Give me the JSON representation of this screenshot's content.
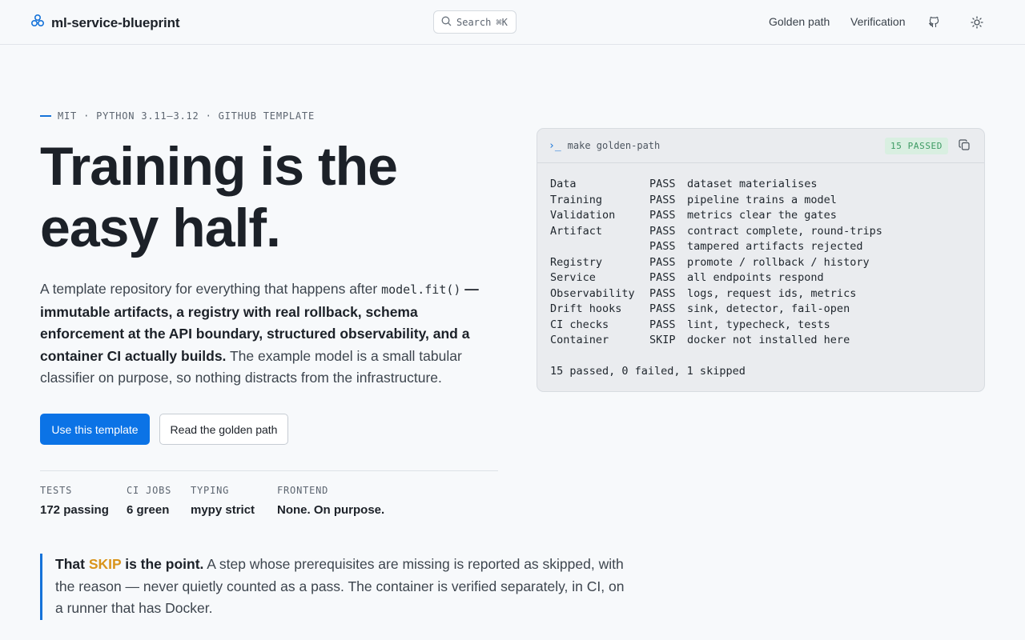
{
  "header": {
    "brand": "ml-service-blueprint",
    "brand_icon": "cube-cluster-icon",
    "search_label": "Search",
    "search_shortcut": "⌘K",
    "nav": [
      {
        "label": "Golden path"
      },
      {
        "label": "Verification"
      }
    ],
    "icons": [
      "github-icon",
      "theme-toggle-icon"
    ]
  },
  "hero": {
    "eyebrow": "MIT · PYTHON 3.11–3.12 · GITHUB TEMPLATE",
    "headline_line1": "Training is the",
    "headline_line2": "easy half.",
    "lead_intro": "A template repository for everything that happens after ",
    "lead_code": "model.fit()",
    "lead_strong": " — immutable artifacts, a registry with real rollback, schema enforcement at the API boundary, structured observability, and a container CI actually builds.",
    "lead_outro": " The example model is a small tabular classifier on purpose, so nothing distracts from the infrastructure.",
    "primary_button": "Use this template",
    "secondary_button": "Read the golden path",
    "stats": [
      {
        "label": "TESTS",
        "value": "172 passing"
      },
      {
        "label": "CI JOBS",
        "value": "6 green"
      },
      {
        "label": "TYPING",
        "value": "mypy strict"
      },
      {
        "label": "FRONTEND",
        "value": "None. On purpose."
      }
    ]
  },
  "terminal": {
    "prompt": "›_",
    "command": "make golden-path",
    "badge": "15 PASSED",
    "badge_color": "#3d9a63",
    "rows": [
      {
        "step": "Data",
        "status": "PASS",
        "detail": "dataset materialises"
      },
      {
        "step": "Training",
        "status": "PASS",
        "detail": "pipeline trains a model"
      },
      {
        "step": "Validation",
        "status": "PASS",
        "detail": "metrics clear the gates"
      },
      {
        "step": "Artifact",
        "status": "PASS",
        "detail": "contract complete, round-trips"
      },
      {
        "step": "",
        "status": "PASS",
        "detail": "tampered artifacts rejected"
      },
      {
        "step": "Registry",
        "status": "PASS",
        "detail": "promote / rollback / history"
      },
      {
        "step": "Service",
        "status": "PASS",
        "detail": "all endpoints respond"
      },
      {
        "step": "Observability",
        "status": "PASS",
        "detail": "logs, request ids, metrics"
      },
      {
        "step": "Drift hooks",
        "status": "PASS",
        "detail": "sink, detector, fail-open"
      },
      {
        "step": "CI checks",
        "status": "PASS",
        "detail": "lint, typecheck, tests"
      },
      {
        "step": "Container",
        "status": "SKIP",
        "detail": "docker not installed here"
      }
    ],
    "summary": "15 passed, 0 failed, 1 skipped"
  },
  "callout": {
    "strong_pre": "That ",
    "skip_word": "SKIP",
    "strong_post": " is the point.",
    "body": " A step whose prerequisites are missing is reported as skipped, with the reason — never quietly counted as a pass. The container is verified separately, in CI, on a runner that has Docker."
  },
  "colors": {
    "accent": "#0b73e6",
    "skip": "#d9941b",
    "background": "#f7f9fb"
  }
}
